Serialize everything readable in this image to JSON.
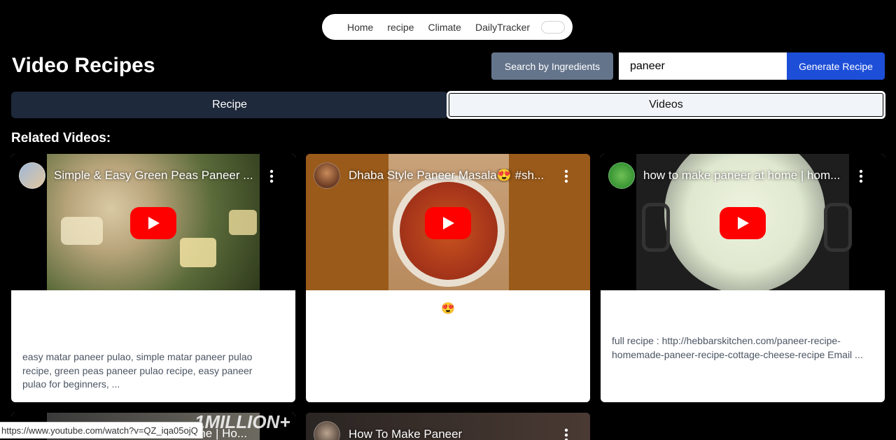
{
  "nav": {
    "items": [
      "Home",
      "recipe",
      "Climate",
      "DailyTracker"
    ]
  },
  "page": {
    "title": "Video Recipes"
  },
  "search": {
    "ingredients_button": "Search by Ingredients",
    "value": "paneer",
    "generate_button": "Generate Recipe"
  },
  "tabs": {
    "recipe": "Recipe",
    "videos": "Videos"
  },
  "section_title": "Related Videos:",
  "videos": [
    {
      "title": "Simple & Easy Green Peas Paneer ...",
      "description": "easy matar paneer pulao, simple matar paneer pulao recipe, green peas paneer pulao recipe, easy paneer pulao for beginners, ..."
    },
    {
      "title": "Dhaba Style Paneer Masala😍 #sh...",
      "description": "😍"
    },
    {
      "title": "how to make paneer at home | hom...",
      "description": "full recipe : http://hebbarskitchen.com/paneer-recipe-homemade-paneer-recipe-cottage-cheese-recipe Email ..."
    },
    {
      "title": "...ome | Ho...",
      "overlay_text": "1MILLION+"
    },
    {
      "title": "How To Make Paneer"
    }
  ],
  "status_bar": {
    "url": "https://www.youtube.com/watch?v=QZ_iqa05ojQ"
  },
  "colors": {
    "background": "#000000",
    "accent_blue": "#1d4ed8",
    "slate_button": "#64748b",
    "tab_dark": "#1e293b",
    "youtube_red": "#ff0000"
  }
}
